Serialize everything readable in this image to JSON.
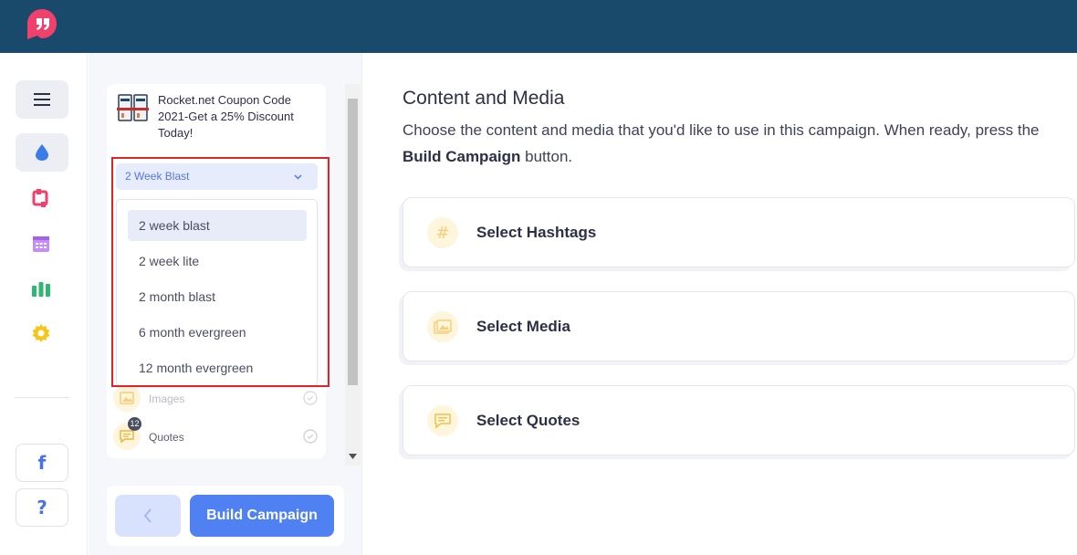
{
  "app": {
    "logo_icon": "quote-bubble-logo"
  },
  "rail": {
    "items": [
      "menu-icon",
      "drop-icon",
      "repeat-icon",
      "calendar-icon",
      "chart-icon",
      "gear-icon"
    ],
    "social": [
      "facebook-icon",
      "help-icon"
    ],
    "facebook_glyph": "f",
    "help_glyph": "?"
  },
  "panel": {
    "post_title": "Rocket.net Coupon Code 2021-Get a 25% Discount Today!",
    "schedule_select": {
      "value": "2 Week Blast"
    },
    "schedule_options": [
      "2 week blast",
      "2 week lite",
      "2 month blast",
      "6 month evergreen",
      "12 month evergreen"
    ],
    "rows": [
      {
        "label": "Images",
        "badge": ""
      },
      {
        "label": "Quotes",
        "badge": "12"
      }
    ],
    "build_button": "Build Campaign"
  },
  "main": {
    "title": "Content and Media",
    "desc_start": "Choose the content and media that you'd like to use in this campaign. When ready, press the ",
    "desc_bold": "Build Campaign",
    "desc_end": " button.",
    "cards": [
      {
        "label": "Select Hashtags",
        "icon": "hashtag-icon",
        "hash_glyph": "#"
      },
      {
        "label": "Select Media",
        "icon": "image-icon"
      },
      {
        "label": "Select Quotes",
        "icon": "quote-icon"
      }
    ]
  },
  "colors": {
    "topbar": "#1a4a6b",
    "brand": "#f0416c",
    "primary": "#5081f2",
    "highlight": "#d9262a"
  }
}
